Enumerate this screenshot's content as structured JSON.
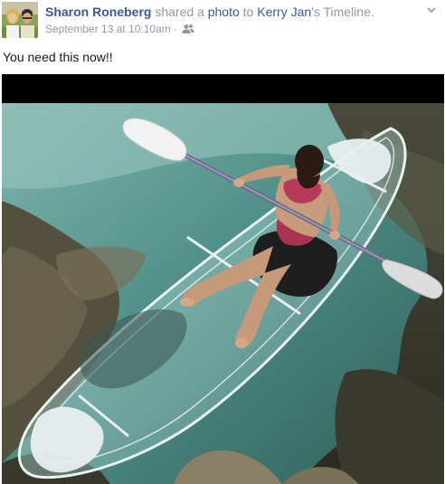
{
  "post": {
    "author": "Sharon Roneberg",
    "action_text": " shared a ",
    "object_link": "photo",
    "to_text": " to ",
    "target_name": "Kerry Jan",
    "target_suffix": "'s Timeline.",
    "timestamp": "September 13 at 10:10am",
    "separator": " · ",
    "privacy_icon": "friends-icon",
    "menu_icon": "chevron-down-icon",
    "message": "You need this now!!"
  },
  "colors": {
    "link": "#3b5998",
    "meta": "#9197a3",
    "text": "#141823"
  }
}
